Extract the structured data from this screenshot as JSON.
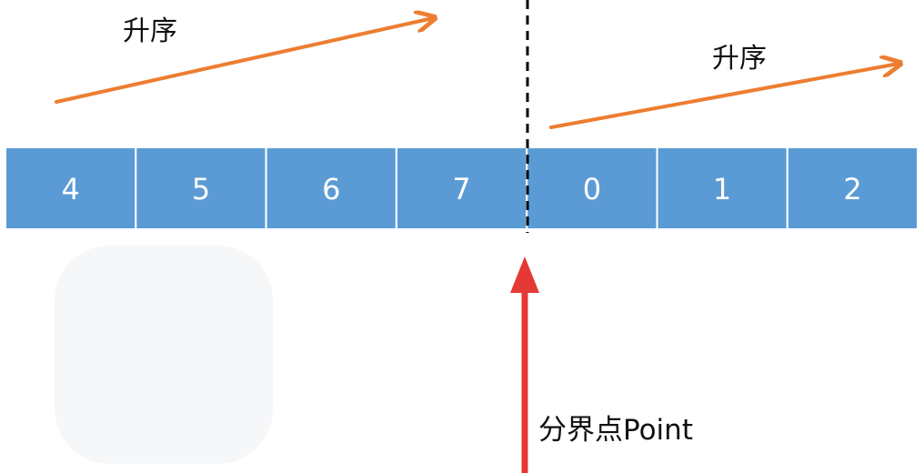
{
  "labels": {
    "ascending_left": "升序",
    "ascending_right": "升序",
    "split_point": "分界点Point"
  },
  "array": {
    "cells": [
      "4",
      "5",
      "6",
      "7",
      "0",
      "1",
      "2"
    ],
    "pivot_index": 4
  },
  "colors": {
    "cell_fill": "#5b9bd5",
    "cell_border": "#ffffff",
    "cell_text": "#ffffff",
    "ascending_arrow": "#ed7d31",
    "split_arrow": "#e53935",
    "divider": "#000000"
  },
  "watermark": {
    "icon": "watermark-logo-icon"
  }
}
